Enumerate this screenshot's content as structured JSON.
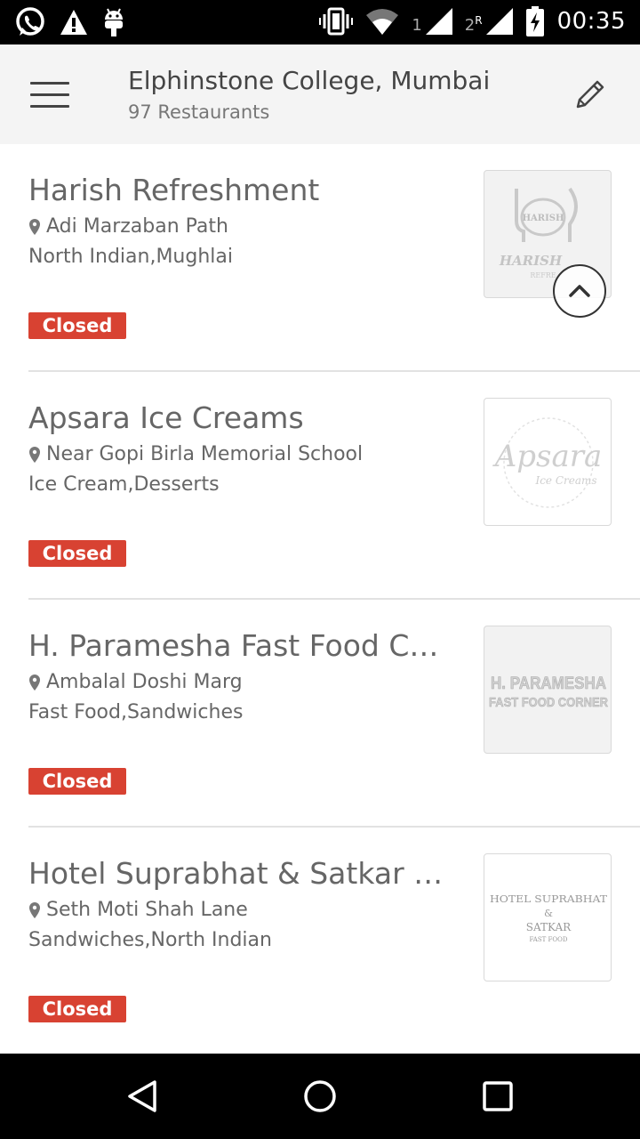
{
  "status_bar": {
    "time": "00:35",
    "sim1": "1",
    "sim2": "2",
    "roaming": "R",
    "icons": [
      "whatsapp-icon",
      "warning-icon",
      "android-icon",
      "vibrate-icon",
      "wifi-icon",
      "signal-icon",
      "signal-icon",
      "battery-charging-icon"
    ]
  },
  "app_bar": {
    "title": "Elphinstone College, Mumbai",
    "subtitle": "97 Restaurants",
    "menu_icon": "hamburger-menu-icon",
    "edit_icon": "pencil-icon"
  },
  "restaurants": [
    {
      "name": "Harish Refreshment",
      "location": "Adi Marzaban Path",
      "cuisine": "North Indian,Mughlai",
      "status": "Closed",
      "logo_line1": "HARISH",
      "logo_line2": "HARISH",
      "logo_line3": "REFRE"
    },
    {
      "name": "Apsara Ice Creams",
      "location": "Near Gopi Birla Memorial School",
      "cuisine": "Ice Cream,Desserts",
      "status": "Closed",
      "logo_line1": "Apsara",
      "logo_line2": "Ice Creams"
    },
    {
      "name": "H. Paramesha Fast Food Corner",
      "location": "Ambalal Doshi Marg",
      "cuisine": "Fast Food,Sandwiches",
      "status": "Closed",
      "logo_line1": "H. PARAMESHA",
      "logo_line2": "FAST FOOD CORNER"
    },
    {
      "name": "Hotel Suprabhat & Satkar Fast Food",
      "location": "Seth Moti Shah Lane",
      "cuisine": "Sandwiches,North Indian",
      "status": "Closed",
      "logo_line1": "HOTEL SUPRABHAT",
      "logo_line2": "&",
      "logo_line3": "SATKAR",
      "logo_line4": "FAST FOOD"
    }
  ],
  "colors": {
    "closed_badge": "#d84232",
    "app_bar_bg": "#f4f4f4",
    "text": "#666666"
  },
  "nav_bar": {
    "back_icon": "back-triangle-icon",
    "home_icon": "home-circle-icon",
    "recents_icon": "recents-square-icon"
  }
}
